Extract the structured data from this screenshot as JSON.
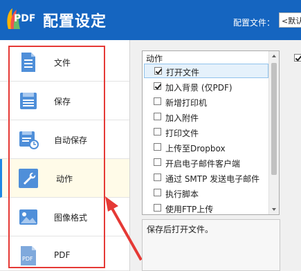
{
  "header": {
    "logo_text": "PDF",
    "title": "配置设定",
    "profile_label": "配置文件：",
    "profile_value": "<默认"
  },
  "colors": {
    "header_bg": "#1565c0",
    "accent": "#1e88e5",
    "highlight": "#e53935"
  },
  "sidebar": {
    "items": [
      {
        "label": "文件",
        "icon": "document-icon",
        "active": false
      },
      {
        "label": "保存",
        "icon": "save-icon",
        "active": false
      },
      {
        "label": "自动保存",
        "icon": "autosave-icon",
        "active": false
      },
      {
        "label": "动作",
        "icon": "wrench-icon",
        "active": true
      },
      {
        "label": "图像格式",
        "icon": "image-icon",
        "active": false
      },
      {
        "label": "PDF",
        "icon": "pdf-file-icon",
        "active": false
      }
    ]
  },
  "actions": {
    "header": "动作",
    "items": [
      {
        "label": "打开文件",
        "checked": true,
        "selected": true
      },
      {
        "label": "加入背景 (仅PDF)",
        "checked": true,
        "selected": false
      },
      {
        "label": "新增打印机",
        "checked": false,
        "selected": false
      },
      {
        "label": "加入附件",
        "checked": false,
        "selected": false
      },
      {
        "label": "打印文件",
        "checked": false,
        "selected": false
      },
      {
        "label": "上传至Dropbox",
        "checked": false,
        "selected": false
      },
      {
        "label": "开启电子邮件客户端",
        "checked": false,
        "selected": false
      },
      {
        "label": "通过 SMTP 发送电子邮件",
        "checked": false,
        "selected": false
      },
      {
        "label": "执行脚本",
        "checked": false,
        "selected": false
      },
      {
        "label": "使用FTP上传",
        "checked": false,
        "selected": false
      }
    ],
    "description": "保存后打开文件。"
  }
}
